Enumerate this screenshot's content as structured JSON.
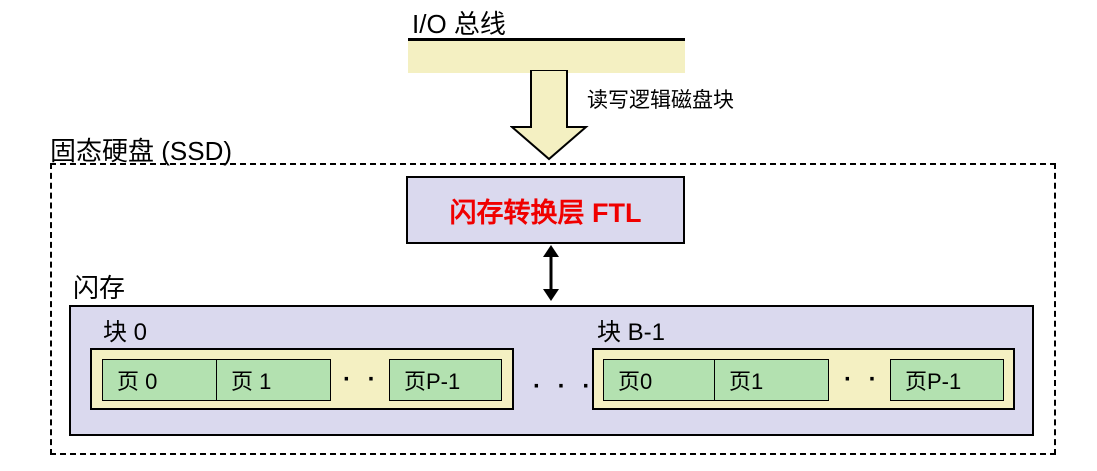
{
  "bus": {
    "label": "I/O 总线"
  },
  "arrow_label": "读写逻辑磁盘块",
  "ssd": {
    "label": "固态硬盘 (SSD)"
  },
  "ftl": {
    "label": "闪存转换层 FTL"
  },
  "flash": {
    "label": "闪存",
    "blocks": [
      {
        "label": "块 0",
        "pages": [
          "页 0",
          "页 1",
          "页P-1"
        ],
        "ellipsis": "· · ·"
      },
      {
        "label": "块  B-1",
        "pages": [
          "页0",
          "页1",
          "页P-1"
        ],
        "ellipsis": "· · ·"
      }
    ],
    "between_blocks": "· · ·"
  },
  "colors": {
    "bus_fill": "#f4f0c2",
    "ftl_fill": "#dad9ee",
    "ftl_text": "#f00000",
    "flash_fill": "#dad9ee",
    "block_fill": "#f4f0c2",
    "page_fill": "#b3e1b0"
  }
}
